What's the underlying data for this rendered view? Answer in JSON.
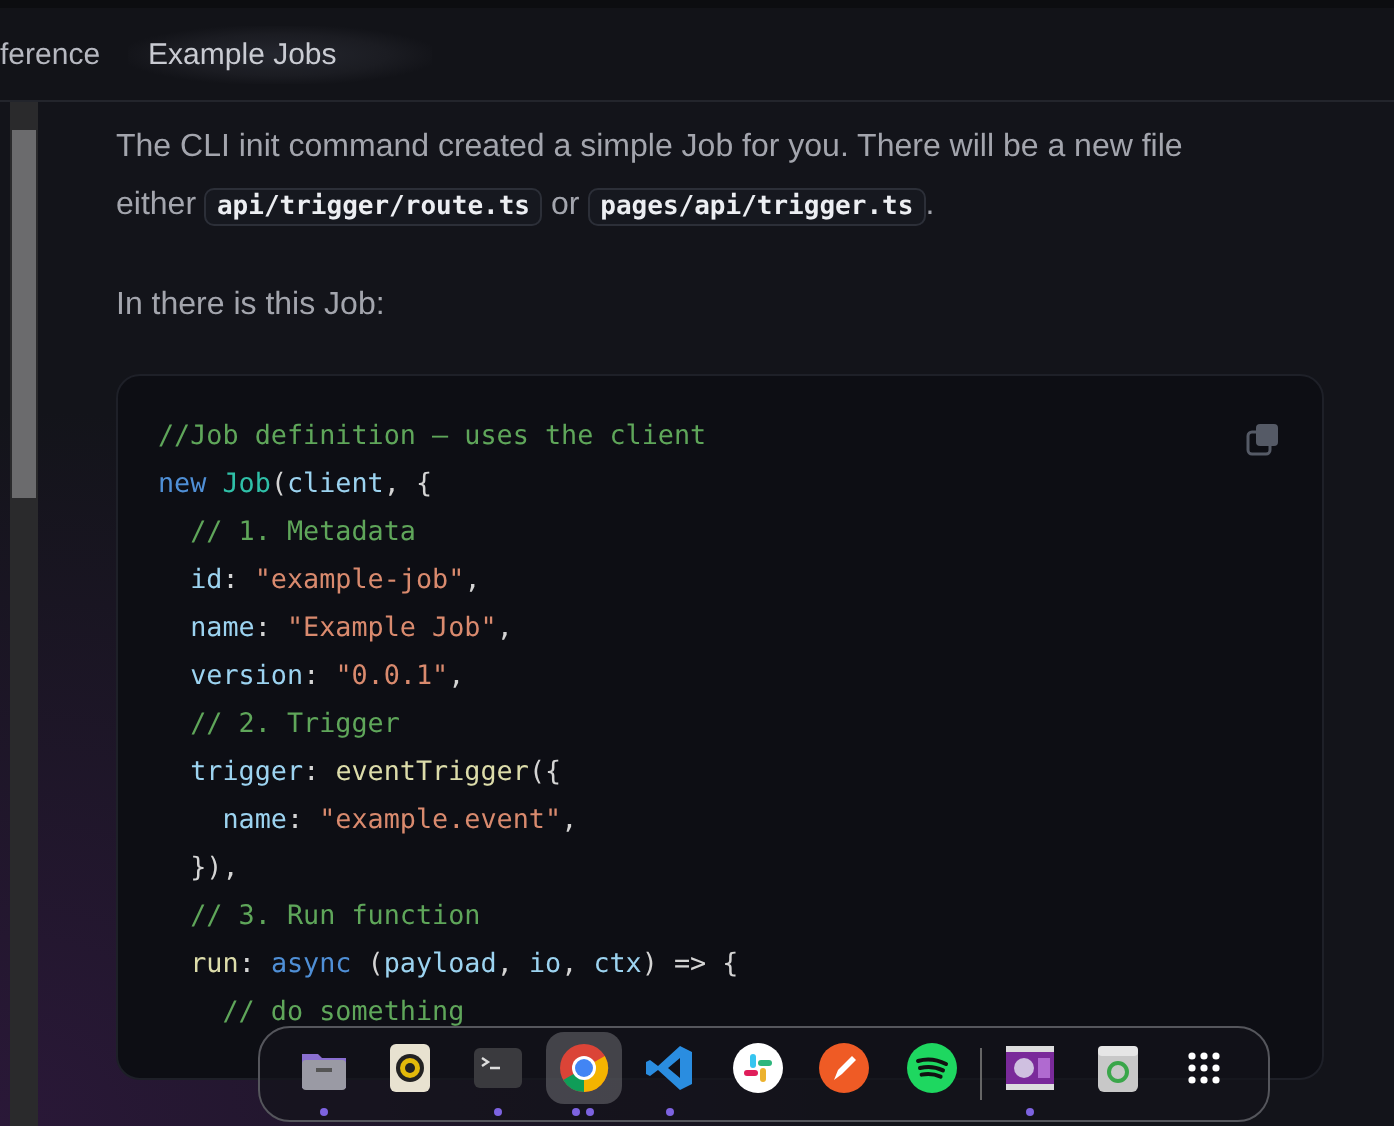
{
  "nav": {
    "links": [
      {
        "label": "ference",
        "selected": false
      },
      {
        "label": "Example Jobs",
        "selected": true
      }
    ]
  },
  "content": {
    "paragraphs": [
      {
        "parts": [
          {
            "kind": "text",
            "text": "The CLI init command created a simple Job for you. There will be a new file either "
          },
          {
            "kind": "code",
            "text": "api/trigger/route.ts"
          },
          {
            "kind": "text",
            "text": " or "
          },
          {
            "kind": "code",
            "text": "pages/api/trigger.ts"
          },
          {
            "kind": "text",
            "text": "."
          }
        ]
      },
      {
        "parts": [
          {
            "kind": "text",
            "text": "In there is this Job:"
          }
        ]
      }
    ],
    "code_block": {
      "lines": [
        [
          {
            "kind": "comment",
            "text": "//Job definition – uses the client"
          }
        ],
        [
          {
            "kind": "keyword",
            "text": "new "
          },
          {
            "kind": "class",
            "text": "Job"
          },
          {
            "kind": "plain",
            "text": "("
          },
          {
            "kind": "prop",
            "text": "client"
          },
          {
            "kind": "plain",
            "text": ", {"
          }
        ],
        [
          {
            "kind": "comment",
            "text": "  // 1. Metadata"
          }
        ],
        [
          {
            "kind": "prop",
            "text": "  id"
          },
          {
            "kind": "plain",
            "text": ": "
          },
          {
            "kind": "string",
            "text": "\"example-job\""
          },
          {
            "kind": "plain",
            "text": ","
          }
        ],
        [
          {
            "kind": "prop",
            "text": "  name"
          },
          {
            "kind": "plain",
            "text": ": "
          },
          {
            "kind": "string",
            "text": "\"Example Job\""
          },
          {
            "kind": "plain",
            "text": ","
          }
        ],
        [
          {
            "kind": "prop",
            "text": "  version"
          },
          {
            "kind": "plain",
            "text": ": "
          },
          {
            "kind": "string",
            "text": "\"0.0.1\""
          },
          {
            "kind": "plain",
            "text": ","
          }
        ],
        [
          {
            "kind": "comment",
            "text": "  // 2. Trigger"
          }
        ],
        [
          {
            "kind": "prop",
            "text": "  trigger"
          },
          {
            "kind": "plain",
            "text": ": "
          },
          {
            "kind": "func",
            "text": "eventTrigger"
          },
          {
            "kind": "plain",
            "text": "({"
          }
        ],
        [
          {
            "kind": "prop",
            "text": "    name"
          },
          {
            "kind": "plain",
            "text": ": "
          },
          {
            "kind": "string",
            "text": "\"example.event\""
          },
          {
            "kind": "plain",
            "text": ","
          }
        ],
        [
          {
            "kind": "plain",
            "text": "  }),"
          }
        ],
        [
          {
            "kind": "comment",
            "text": "  // 3. Run function"
          }
        ],
        [
          {
            "kind": "func",
            "text": "  run"
          },
          {
            "kind": "plain",
            "text": ": "
          },
          {
            "kind": "keyword",
            "text": "async"
          },
          {
            "kind": "plain",
            "text": " ("
          },
          {
            "kind": "prop",
            "text": "payload"
          },
          {
            "kind": "plain",
            "text": ", "
          },
          {
            "kind": "prop",
            "text": "io"
          },
          {
            "kind": "plain",
            "text": ", "
          },
          {
            "kind": "prop",
            "text": "ctx"
          },
          {
            "kind": "plain",
            "text": ") => {"
          }
        ],
        [
          {
            "kind": "comment",
            "text": "    // do something"
          }
        ]
      ]
    }
  },
  "dock": {
    "items": [
      {
        "kind": "folder",
        "running": true,
        "multiple": false,
        "selected": false
      },
      {
        "kind": "speaker",
        "running": false,
        "selected": false
      },
      {
        "kind": "terminal",
        "running": true,
        "multiple": false,
        "selected": false
      },
      {
        "kind": "browser",
        "running": true,
        "multiple": true,
        "selected": true
      },
      {
        "kind": "editor",
        "running": true,
        "multiple": false,
        "selected": false
      },
      {
        "kind": "chat",
        "running": false,
        "selected": false
      },
      {
        "kind": "pen",
        "running": false,
        "selected": false
      },
      {
        "kind": "music",
        "running": false,
        "selected": false
      },
      {
        "kind": "separator"
      },
      {
        "kind": "film",
        "running": true,
        "multiple": false,
        "selected": false
      },
      {
        "kind": "trash",
        "running": false,
        "selected": false
      },
      {
        "kind": "apps",
        "running": false,
        "selected": false
      }
    ]
  }
}
